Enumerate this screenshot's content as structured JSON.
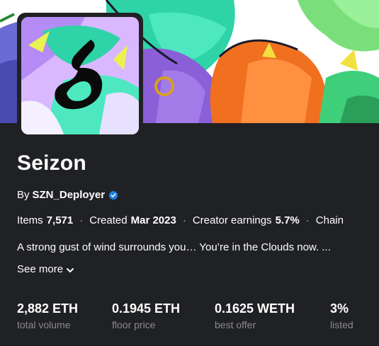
{
  "collection": {
    "name": "Seizon",
    "by_label": "By",
    "creator": "SZN_Deployer",
    "verified": true
  },
  "stats": [
    {
      "label": "Items",
      "value": "7,571"
    },
    {
      "label": "Created",
      "value": "Mar 2023"
    },
    {
      "label": "Creator earnings",
      "value": "5.7%"
    },
    {
      "label": "Chain",
      "value": ""
    }
  ],
  "description": "A strong gust of wind surrounds you… You’re in the Clouds now. ...",
  "see_more": "See more",
  "metrics": [
    {
      "value": "2,882 ETH",
      "label": "total volume"
    },
    {
      "value": "0.1945 ETH",
      "label": "floor price"
    },
    {
      "value": "0.1625 WETH",
      "label": "best offer"
    },
    {
      "value": "3%",
      "label": "listed"
    }
  ],
  "colors": {
    "background": "#202124",
    "verified_badge": "#2081e2",
    "muted_text": "#8a8a8e"
  },
  "icons": [
    "verified-badge-icon",
    "chevron-down-icon"
  ]
}
